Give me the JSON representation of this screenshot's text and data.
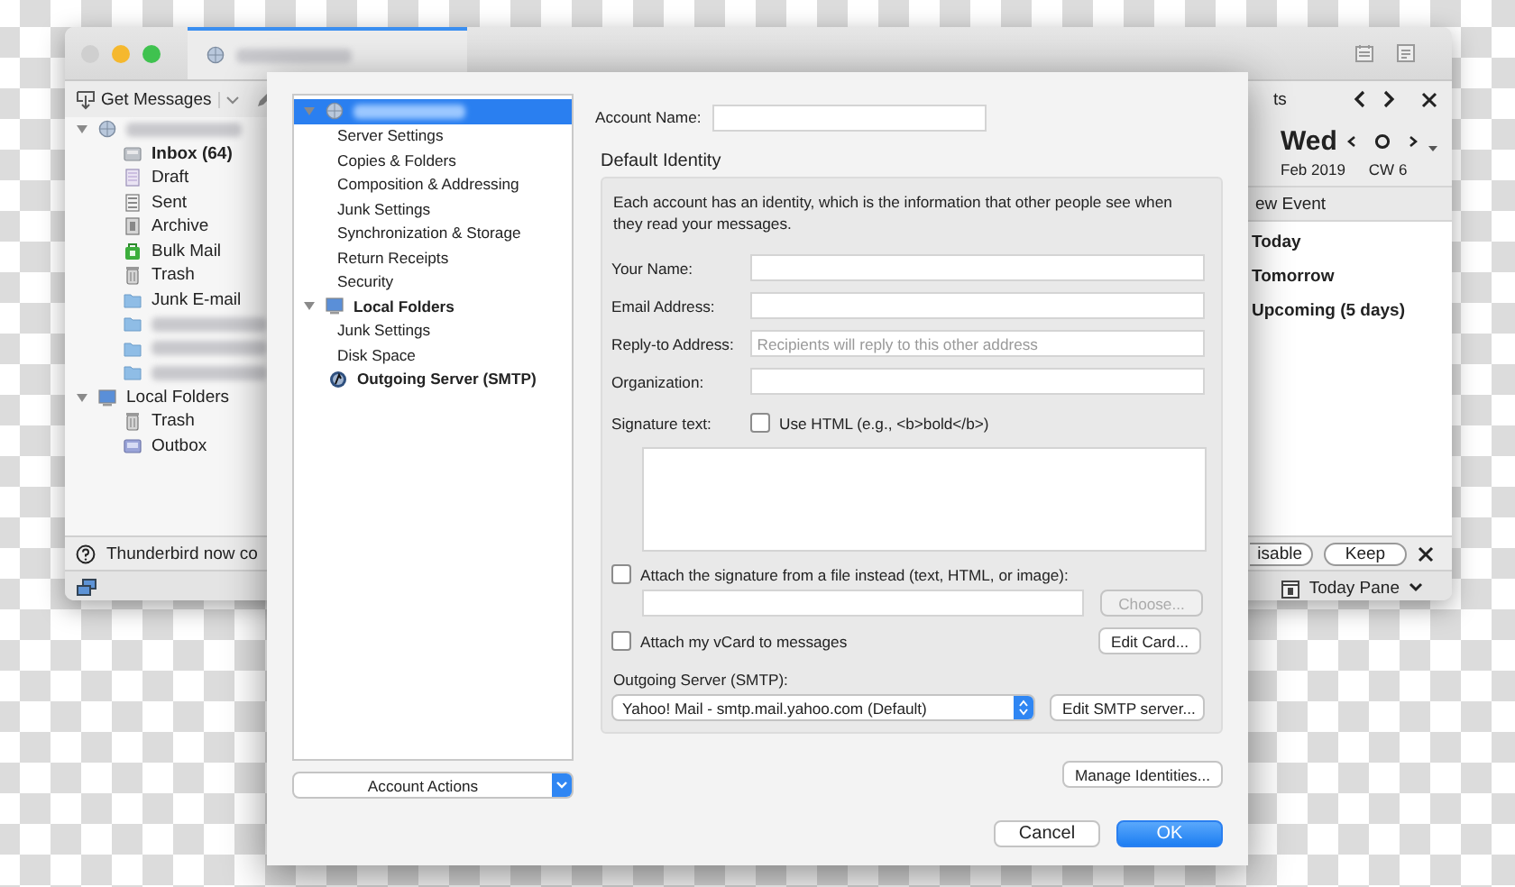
{
  "main_window": {
    "toolbar": {
      "get_messages": "Get Messages",
      "events_header": "ts"
    },
    "folder_tree": [
      {
        "kind": "account",
        "expanded": true,
        "children": [
          {
            "kind": "inbox",
            "label": "Inbox (64)",
            "unread": true
          },
          {
            "kind": "draft",
            "label": "Draft",
            "unread": false
          },
          {
            "kind": "sent",
            "label": "Sent",
            "unread": false
          },
          {
            "kind": "archive",
            "label": "Archive",
            "unread": false
          },
          {
            "kind": "bulk",
            "label": "Bulk Mail",
            "unread": false
          },
          {
            "kind": "trash",
            "label": "Trash",
            "unread": false
          },
          {
            "kind": "folder",
            "label": "Junk E-mail",
            "unread": false
          },
          {
            "kind": "blurred-folder"
          },
          {
            "kind": "blurred-folder"
          },
          {
            "kind": "blurred-folder"
          }
        ]
      },
      {
        "kind": "local",
        "label": "Local Folders",
        "unread": false,
        "expanded": true,
        "children": [
          {
            "kind": "trash",
            "label": "Trash",
            "unread": false
          },
          {
            "kind": "outbox",
            "label": "Outbox",
            "unread": false
          }
        ]
      }
    ],
    "calendar": {
      "day": "Wed",
      "month": "Feb 2019",
      "week": "CW 6",
      "new_event": "ew Event",
      "sections": [
        "Today",
        "Tomorrow",
        "Upcoming (5 days)"
      ]
    },
    "notification": {
      "text": "Thunderbird now co",
      "buttons": [
        "isable",
        "Keep"
      ]
    },
    "status_bar": {
      "today_pane": "Today Pane"
    }
  },
  "dialog": {
    "tree": [
      {
        "kind": "account",
        "selected": true,
        "expanded": true,
        "children": [
          {
            "label": "Server Settings",
            "selected": false
          },
          {
            "label": "Copies & Folders",
            "selected": false
          },
          {
            "label": "Composition & Addressing",
            "selected": false
          },
          {
            "label": "Junk Settings",
            "selected": false
          },
          {
            "label": "Synchronization & Storage",
            "selected": false
          },
          {
            "label": "Return Receipts",
            "selected": false
          },
          {
            "label": "Security",
            "selected": false
          }
        ]
      },
      {
        "kind": "local",
        "label": "Local Folders",
        "selected": false,
        "expanded": true,
        "children": [
          {
            "label": "Junk Settings",
            "selected": false
          },
          {
            "label": "Disk Space",
            "selected": false
          }
        ]
      },
      {
        "kind": "smtp",
        "label": "Outgoing Server (SMTP)",
        "selected": false
      }
    ],
    "account_actions": "Account Actions",
    "account_name_label": "Account Name:",
    "identity_title": "Default Identity",
    "identity_description": "Each account has an identity, which is the information that other people see when they read your messages.",
    "fields": [
      {
        "label": "Your Name:"
      },
      {
        "label": "Email Address:"
      },
      {
        "label": "Reply-to Address:",
        "placeholder": "Recipients will reply to this other address"
      },
      {
        "label": "Organization:"
      }
    ],
    "signature_label": "Signature text:",
    "use_html": {
      "label": "Use HTML (e.g., <b>bold</b>)",
      "checked": false
    },
    "attach_signature": {
      "label": "Attach the signature from a file instead (text, HTML, or image):",
      "checked": false
    },
    "choose_button": {
      "label": "Choose...",
      "disabled": true
    },
    "attach_vcard": {
      "label": "Attach my vCard to messages",
      "checked": false
    },
    "edit_card": "Edit Card...",
    "smtp_label": "Outgoing Server (SMTP):",
    "smtp_select": "Yahoo! Mail - smtp.mail.yahoo.com (Default)",
    "edit_smtp": "Edit SMTP server...",
    "manage_identities": "Manage Identities...",
    "buttons": [
      {
        "label": "Cancel",
        "default": false
      },
      {
        "label": "OK",
        "default": true
      }
    ]
  }
}
